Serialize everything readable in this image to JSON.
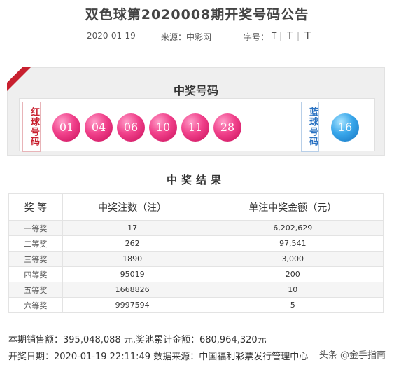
{
  "header": {
    "title": "双色球第2020008期开奖号码公告",
    "date": "2020-01-19",
    "source": "来源：中彩网",
    "font_size_label": "字号：",
    "font_options": [
      "T",
      "T",
      "T"
    ]
  },
  "draw": {
    "title": "中奖号码",
    "red_label": "红球号码",
    "blue_label": "蓝球号码",
    "red_balls": [
      "01",
      "04",
      "06",
      "10",
      "11",
      "28"
    ],
    "blue_ball": "16",
    "colors": {
      "accent": "#c8202f",
      "red_ball": "#f0408a",
      "blue_ball": "#38a6ea"
    }
  },
  "results": {
    "title": "中奖结果",
    "headers": [
      "奖 等",
      "中奖注数（注）",
      "单注中奖金额（元）"
    ],
    "rows": [
      [
        "一等奖",
        "17",
        "6,202,629"
      ],
      [
        "二等奖",
        "262",
        "97,541"
      ],
      [
        "三等奖",
        "1890",
        "3,000"
      ],
      [
        "四等奖",
        "95019",
        "200"
      ],
      [
        "五等奖",
        "1668826",
        "10"
      ],
      [
        "六等奖",
        "9997594",
        "5"
      ]
    ]
  },
  "footer": {
    "sales": "本期销售额：395,048,088 元,奖池累计金额：680,964,320元",
    "draw_info": "开奖日期：2020-01-19  22:11:49  数据来源：中国福利彩票发行管理中心"
  },
  "watermark": "头条 @金手指南"
}
